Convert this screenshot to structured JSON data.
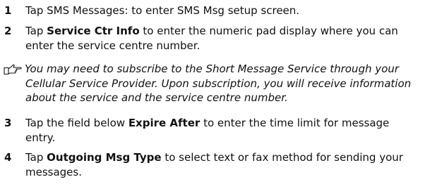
{
  "steps": [
    {
      "number": "1",
      "lines": [
        {
          "pre": "Tap SMS Messages: to enter SMS Msg setup screen."
        }
      ]
    },
    {
      "number": "2",
      "lines": [
        {
          "pre": "Tap ",
          "bold": "Service Ctr Info",
          "post": " to enter the numeric pad display where you can"
        },
        {
          "pre": "enter the service centre number."
        }
      ]
    },
    {
      "number": "3",
      "lines": [
        {
          "pre": "Tap the field below ",
          "bold": "Expire After",
          "post": " to enter the time limit for message"
        },
        {
          "pre": "entry."
        }
      ]
    },
    {
      "number": "4",
      "lines": [
        {
          "pre": "Tap ",
          "bold": "Outgoing Msg Type",
          "post": " to select text or fax method for sending your"
        },
        {
          "pre": "messages."
        }
      ]
    }
  ],
  "note": {
    "icon": "pointing-hand-icon",
    "lines": [
      "You may need to subscribe to the Short Message Service through your",
      "Cellular Service Provider. Upon subscription, you will receive information",
      "about the service and the service centre number."
    ]
  }
}
